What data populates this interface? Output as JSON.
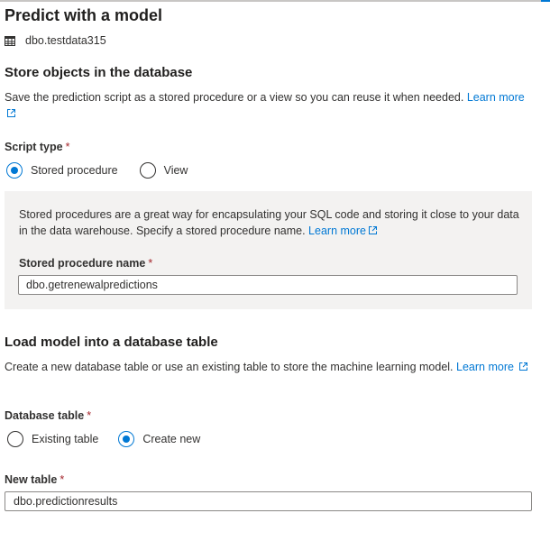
{
  "header": {
    "title": "Predict with a model",
    "table_icon": "table-grid-icon",
    "table_name": "dbo.testdata315"
  },
  "store_section": {
    "title": "Store objects in the database",
    "description": "Save the prediction script as a stored procedure or a view so you can reuse it when needed.",
    "learn_more": "Learn more",
    "script_type": {
      "label": "Script type",
      "required_mark": "*",
      "options": [
        "Stored procedure",
        "View"
      ],
      "selected": "Stored procedure"
    },
    "info_panel": {
      "description": "Stored procedures are a great way for encapsulating your SQL code and storing it close to your data in the data warehouse. Specify a stored procedure name.",
      "learn_more": "Learn more",
      "field_label": "Stored procedure name",
      "required_mark": "*",
      "field_value": "dbo.getrenewalpredictions"
    }
  },
  "load_section": {
    "title": "Load model into a database table",
    "description": "Create a new database table or use an existing table to store the machine learning model.",
    "learn_more": "Learn more",
    "database_table": {
      "label": "Database table",
      "required_mark": "*",
      "options": [
        "Existing table",
        "Create new"
      ],
      "selected": "Create new"
    },
    "new_table": {
      "label": "New table",
      "required_mark": "*",
      "value": "dbo.predictionresults"
    }
  },
  "colors": {
    "accent": "#0078d4",
    "required": "#a4262c",
    "panel_background": "#f3f2f1"
  }
}
